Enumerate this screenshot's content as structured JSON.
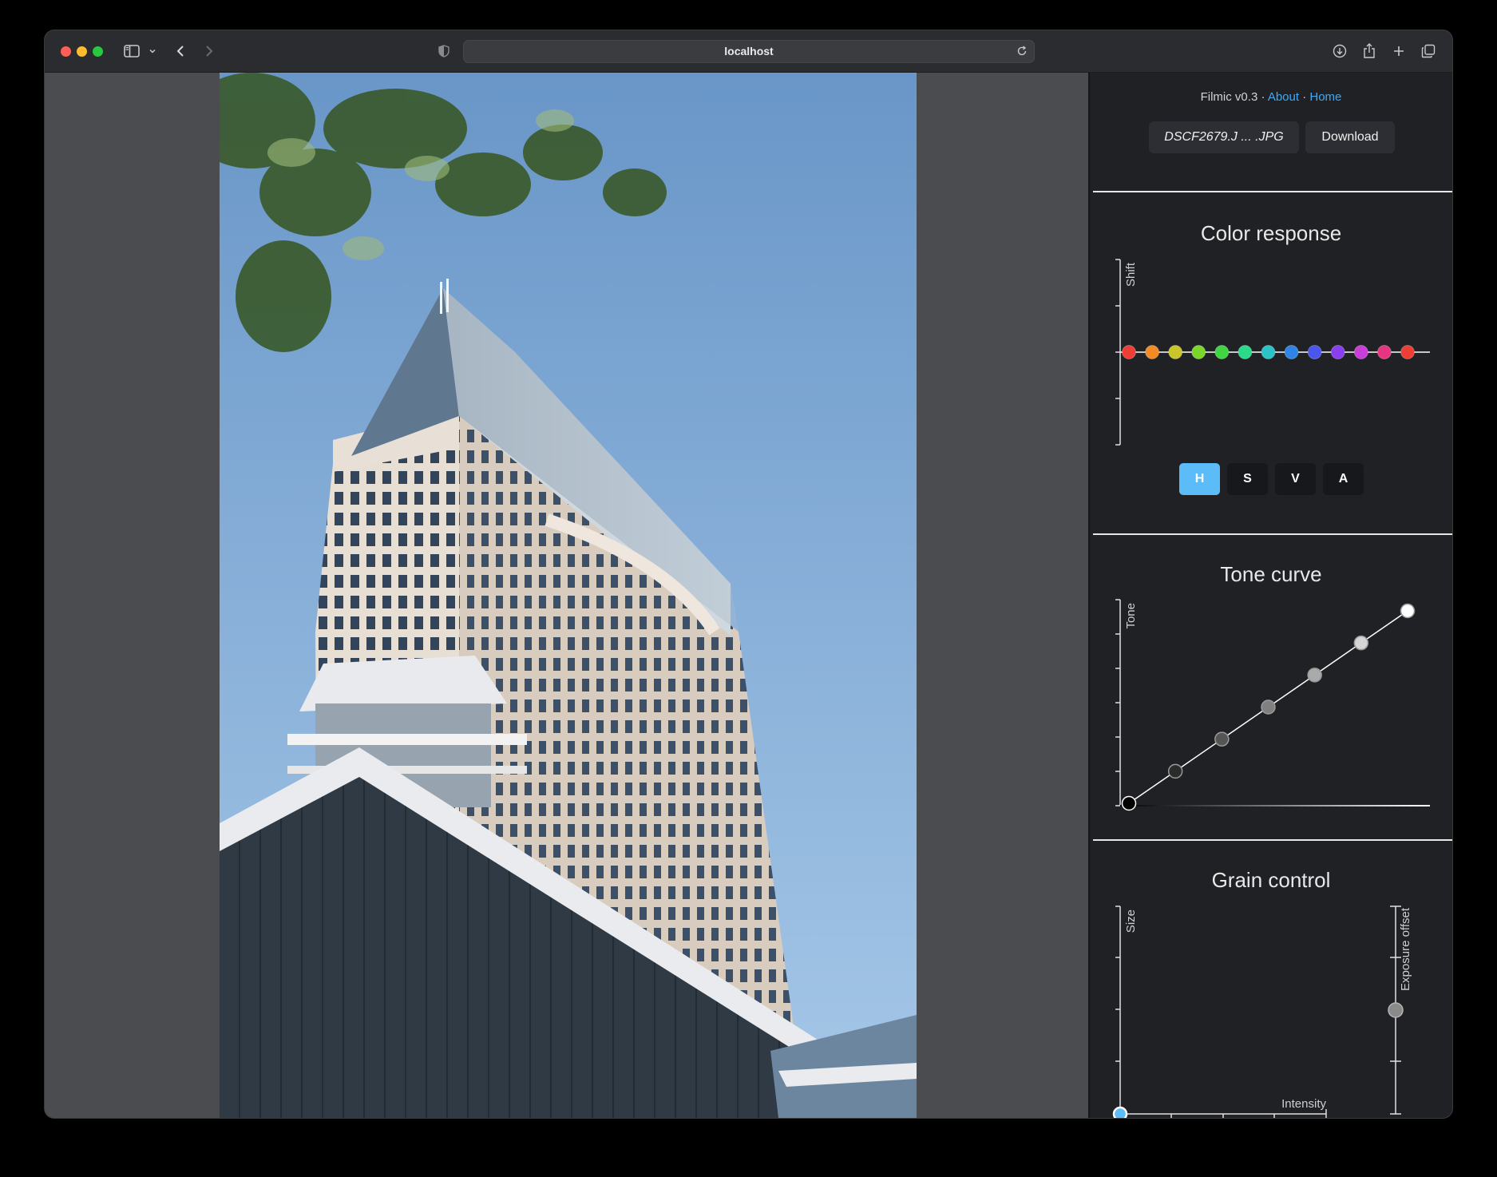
{
  "browser": {
    "url": "localhost"
  },
  "sidebar": {
    "credits": {
      "version": "Filmic v0.3",
      "sep": "·",
      "about": "About",
      "home": "Home"
    },
    "file_name": "DSCF2679.J ... .JPG",
    "download_label": "Download",
    "color_response": {
      "title": "Color response",
      "axis_label": "Shift",
      "hue_points": [
        "#ef3e36",
        "#f28a26",
        "#c9c52a",
        "#7ad62b",
        "#3fd642",
        "#2bd98a",
        "#2bc2c9",
        "#2f84e8",
        "#4a56ee",
        "#8a3ef0",
        "#c93ed8",
        "#e8357f",
        "#ef3e36"
      ],
      "modes": [
        "H",
        "S",
        "V",
        "A"
      ],
      "active_mode": "H"
    },
    "tone_curve": {
      "title": "Tone curve",
      "axis_label": "Tone",
      "points": [
        [
          0,
          0
        ],
        [
          1,
          1
        ],
        [
          2,
          2
        ],
        [
          3,
          3
        ],
        [
          4,
          4
        ],
        [
          5,
          5
        ],
        [
          6,
          6
        ]
      ]
    },
    "grain_control": {
      "title": "Grain control",
      "size_label": "Size",
      "intensity_label": "Intensity",
      "exposure_label": "Exposure offset",
      "size_value": 0,
      "intensity_value": 0,
      "exposure_value": 0.5
    }
  }
}
